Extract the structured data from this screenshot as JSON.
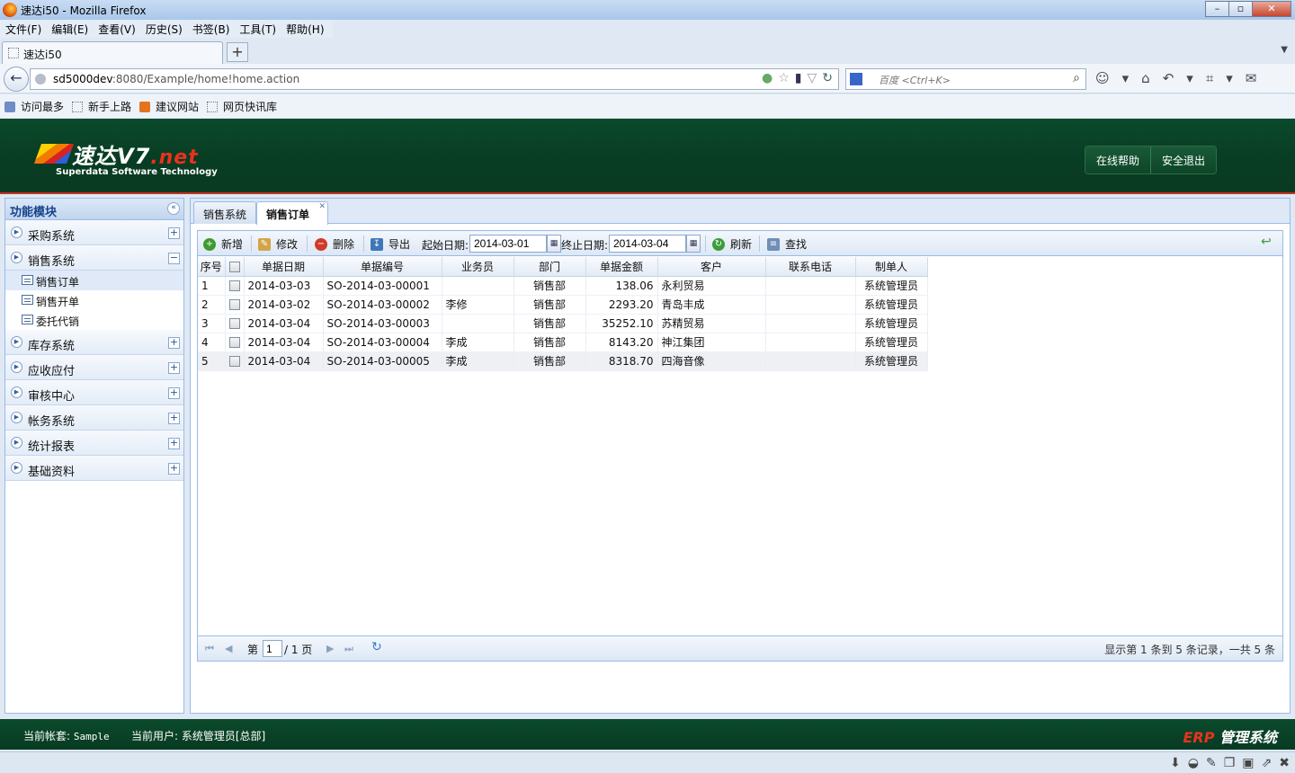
{
  "browser": {
    "window_title": "速达i50 - Mozilla Firefox",
    "menu": [
      "文件(F)",
      "编辑(E)",
      "查看(V)",
      "历史(S)",
      "书签(B)",
      "工具(T)",
      "帮助(H)"
    ],
    "tab_title": "速达i50",
    "url_host": "sd5000dev",
    "url_rest": ":8080/Example/home!home.action",
    "search_placeholder": "百度 <Ctrl+K>",
    "bookmarks": [
      "访问最多",
      "新手上路",
      "建议网站",
      "网页快讯库"
    ]
  },
  "header": {
    "logo_main": "速达V7",
    "logo_net": ".net",
    "logo_sub": "Superdata  Software Technology",
    "help_label": "在线帮助",
    "logout_label": "安全退出"
  },
  "sidebar": {
    "title": "功能模块",
    "modules": [
      {
        "label": "采购系统",
        "expanded": false
      },
      {
        "label": "销售系统",
        "expanded": true,
        "children": [
          "销售订单",
          "销售开单",
          "委托代销"
        ]
      },
      {
        "label": "库存系统",
        "expanded": false
      },
      {
        "label": "应收应付",
        "expanded": false
      },
      {
        "label": "审核中心",
        "expanded": false
      },
      {
        "label": "帐务系统",
        "expanded": false
      },
      {
        "label": "统计报表",
        "expanded": false
      },
      {
        "label": "基础资料",
        "expanded": false
      }
    ]
  },
  "main": {
    "tabs": [
      "销售系统",
      "销售订单"
    ],
    "toolbar": {
      "add": "新增",
      "edit": "修改",
      "delete": "删除",
      "export": "导出",
      "start_label": "起始日期:",
      "start_value": "2014-03-01",
      "end_label": "终止日期:",
      "end_value": "2014-03-04",
      "refresh": "刷新",
      "find": "查找"
    },
    "columns": [
      "序号",
      "",
      "单据日期",
      "单据编号",
      "业务员",
      "部门",
      "单据金额",
      "客户",
      "联系电话",
      "制单人"
    ],
    "rows": [
      {
        "no": "1",
        "date": "2014-03-03",
        "code": "SO-2014-03-00001",
        "salesman": "",
        "dept": "销售部",
        "amount": "138.06",
        "customer": "永利贸易",
        "phone": "",
        "maker": "系统管理员"
      },
      {
        "no": "2",
        "date": "2014-03-02",
        "code": "SO-2014-03-00002",
        "salesman": "李修",
        "dept": "销售部",
        "amount": "2293.20",
        "customer": "青岛丰成",
        "phone": "",
        "maker": "系统管理员"
      },
      {
        "no": "3",
        "date": "2014-03-04",
        "code": "SO-2014-03-00003",
        "salesman": "",
        "dept": "销售部",
        "amount": "35252.10",
        "customer": "苏精贸易",
        "phone": "",
        "maker": "系统管理员"
      },
      {
        "no": "4",
        "date": "2014-03-04",
        "code": "SO-2014-03-00004",
        "salesman": "李成",
        "dept": "销售部",
        "amount": "8143.20",
        "customer": "神江集团",
        "phone": "",
        "maker": "系统管理员"
      },
      {
        "no": "5",
        "date": "2014-03-04",
        "code": "SO-2014-03-00005",
        "salesman": "李成",
        "dept": "销售部",
        "amount": "8318.70",
        "customer": "四海音像",
        "phone": "",
        "maker": "系统管理员"
      }
    ],
    "pager": {
      "page_prefix": "第",
      "page_value": "1",
      "page_suffix": "/ 1 页",
      "info": "显示第 1 条到 5 条记录，一共 5 条"
    }
  },
  "footer": {
    "account_label": "当前帐套:",
    "account_value": "Sample",
    "user_label": "当前用户:",
    "user_value": "系统管理员[总部]",
    "brand_erp": "ERP",
    "brand_rest": " 管理系统"
  }
}
